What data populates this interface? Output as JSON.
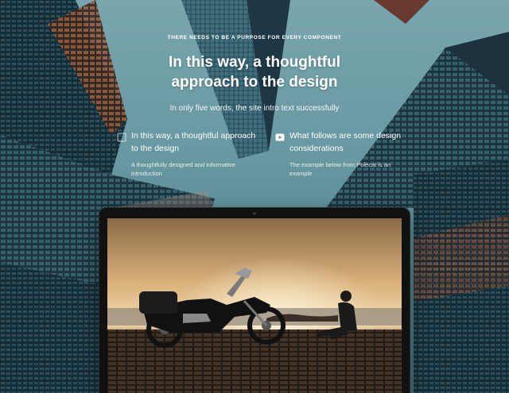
{
  "hero": {
    "eyebrow": "THERE NEEDS TO BE A PURPOSE FOR EVERY COMPONENT",
    "headline": "In this way, a thoughtful approach to the design",
    "intro": "In only five words, the site intro text successfully"
  },
  "features": [
    {
      "icon": "square-outline-icon",
      "title": "In this way, a thoughtful approach to the design",
      "text": "A thoughtfully designed and informative introduction"
    },
    {
      "icon": "play-icon",
      "title": "What follows are some design considerations",
      "text": "The example below from Polecat is an example"
    }
  ],
  "colors": {
    "sky": "#8fc3cb",
    "text": "#ffffff",
    "laptop_bezel": "#111111"
  }
}
